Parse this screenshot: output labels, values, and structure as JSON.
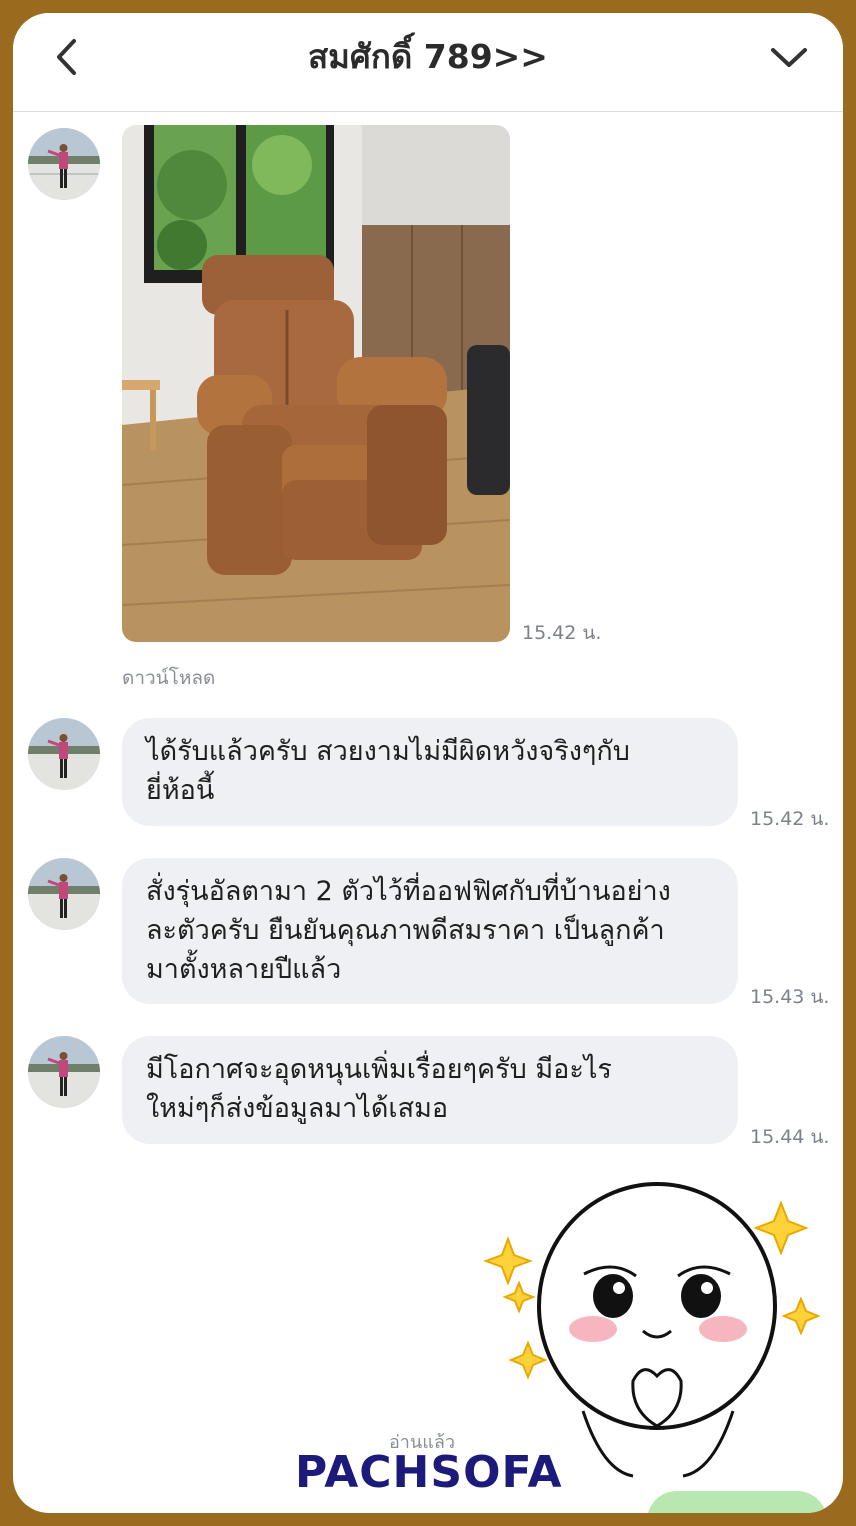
{
  "header": {
    "title": "สมศักดิ์ 789>>"
  },
  "messages": [
    {
      "type": "image",
      "description": "recliner",
      "time": "15.42 น."
    },
    {
      "type": "text",
      "lines": [
        "ได้รับแล้วครับ สวยงามไม่มีผิดหวังจริงๆกับ",
        "ยี่ห้อนี้"
      ],
      "time": "15.42 น."
    },
    {
      "type": "text",
      "lines": [
        "สั่งรุ่นอัลตามา 2 ตัวไว้ที่ออฟฟิศกับที่บ้านอย่าง",
        "ละตัวครับ ยืนยันคุณภาพดีสมราคา เป็นลูกค้า",
        "มาตั้งหลายปีแล้ว"
      ],
      "time": "15.43 น."
    },
    {
      "type": "text",
      "lines": [
        "มีโอกาศจะอุดหนุนเพิ่มเรื่อยๆครับ มีอะไร",
        "ใหม่ๆก็ส่งข้อมูลมาได้เสมอ"
      ],
      "time": "15.44 น."
    }
  ],
  "download_label": "ดาวน์โหลด",
  "read_label": "อ่านแล้ว",
  "watermark": "PACHSOFA",
  "colors": {
    "frame": "#9a6a1f",
    "bubble": "#eef0f3",
    "watermark": "#1c1a7a",
    "sent_bubble": "#b8e8b0"
  },
  "icons": [
    "chevron-left-icon",
    "chevron-down-icon",
    "sparkle-icon"
  ]
}
